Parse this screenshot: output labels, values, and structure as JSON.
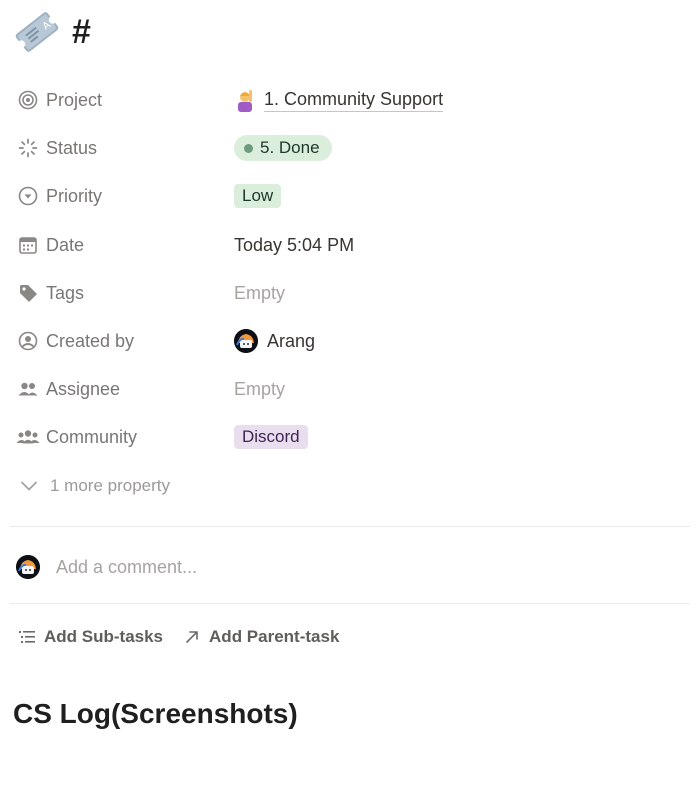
{
  "page": {
    "icon": "ticket-icon",
    "title": "#"
  },
  "properties": [
    {
      "key": "Project",
      "icon": "target-icon",
      "value": "1. Community Support",
      "value_icon": "person-raising-hand-emoji"
    },
    {
      "key": "Status",
      "icon": "loading-spinner-icon",
      "value": "5. Done"
    },
    {
      "key": "Priority",
      "icon": "chevron-circle-icon",
      "value": "Low"
    },
    {
      "key": "Date",
      "icon": "calendar-icon",
      "value": "Today 5:04 PM"
    },
    {
      "key": "Tags",
      "icon": "tag-icon",
      "value": "Empty"
    },
    {
      "key": "Created by",
      "icon": "user-circle-icon",
      "value": "Arang"
    },
    {
      "key": "Assignee",
      "icon": "people-icon",
      "value": "Empty"
    },
    {
      "key": "Community",
      "icon": "group-icon",
      "value": "Discord"
    }
  ],
  "more_property": "1 more property",
  "comment": {
    "placeholder": "Add a comment..."
  },
  "actions": {
    "sub_tasks": "Add Sub-tasks",
    "parent_task": "Add Parent-task"
  },
  "section_heading": "CS Log(Screenshots)",
  "colors": {
    "status_bg": "#dbeddb",
    "status_dot": "#6c9b7d",
    "low_bg": "#dbeddb",
    "discord_bg": "#e8deee",
    "muted_text": "#787774"
  }
}
